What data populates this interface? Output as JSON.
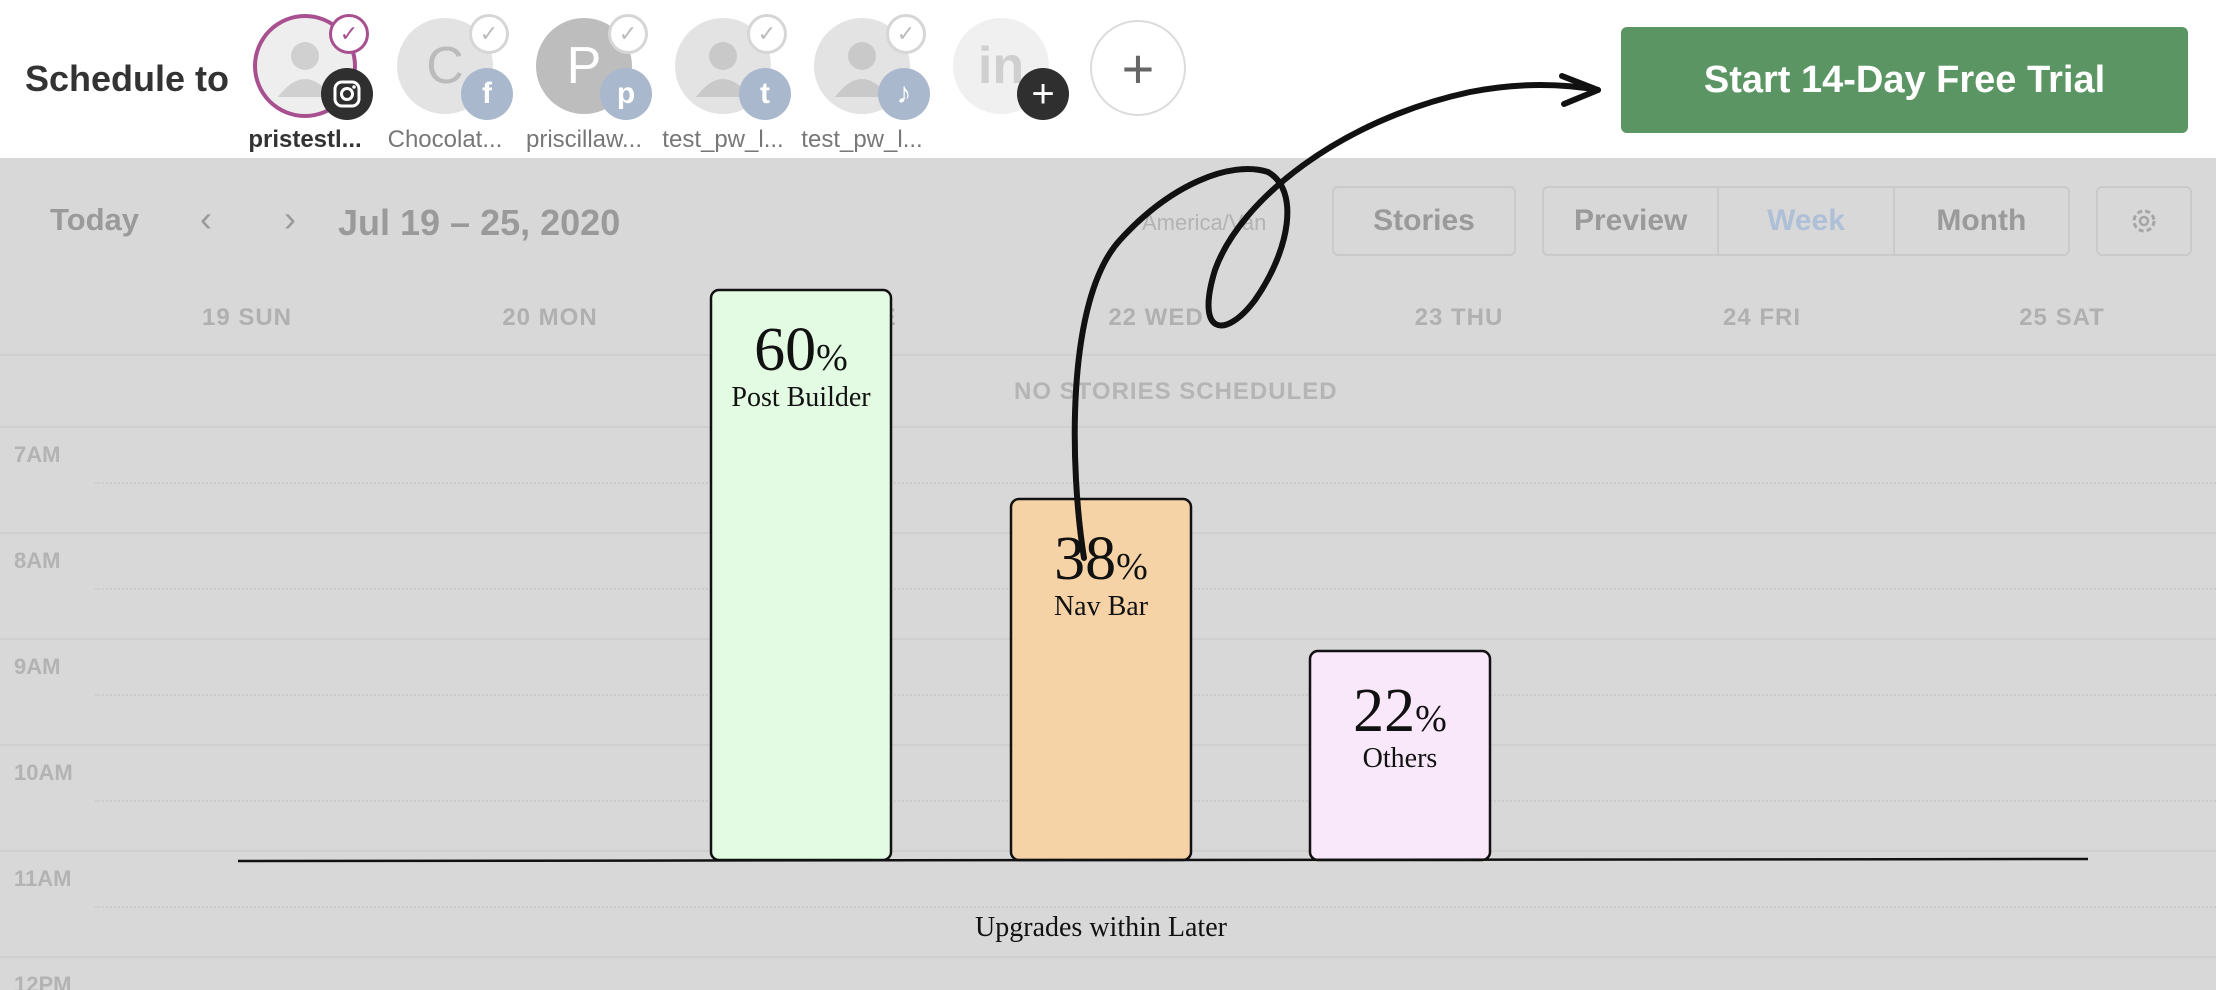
{
  "header": {
    "schedule_label": "Schedule to",
    "accounts": [
      {
        "name": "pristestl...",
        "avatar_letter": "",
        "network": "instagram-icon",
        "network_glyph": "◎",
        "active": true
      },
      {
        "name": "Chocolat...",
        "avatar_letter": "C",
        "network": "facebook-icon",
        "network_glyph": "f",
        "active": false
      },
      {
        "name": "priscillaw...",
        "avatar_letter": "P",
        "network": "pinterest-icon",
        "network_glyph": "p",
        "active": false
      },
      {
        "name": "test_pw_l...",
        "avatar_letter": "",
        "network": "twitter-icon",
        "network_glyph": "t",
        "active": false
      },
      {
        "name": "test_pw_l...",
        "avatar_letter": "",
        "network": "tiktok-icon",
        "network_glyph": "♪",
        "active": false
      },
      {
        "name": "",
        "avatar_letter": "in",
        "network": "add-icon",
        "network_glyph": "+",
        "active": false
      }
    ],
    "add_account_glyph": "+",
    "trial_button": "Start 14-Day Free Trial",
    "trial_color": "#5a9563",
    "accent_color": "#a84f90"
  },
  "calendar": {
    "today": "Today",
    "prev_glyph": "‹",
    "next_glyph": "›",
    "date_range": "Jul 19 – 25, 2020",
    "timezone": "America/Van",
    "stories": "Stories",
    "views": [
      "Preview",
      "Week",
      "Month"
    ],
    "selected_view": "Week",
    "days": [
      "19 SUN",
      "20 MON",
      "21 TUE",
      "22 WED",
      "23 THU",
      "24 FRI",
      "25 SAT"
    ],
    "no_stories": "NO STORIES SCHEDULED",
    "times": [
      "7AM",
      "8AM",
      "9AM",
      "10AM",
      "11AM",
      "12PM"
    ]
  },
  "chart_data": {
    "type": "bar",
    "categories": [
      "Post Builder",
      "Nav Bar",
      "Others"
    ],
    "values": [
      60,
      38,
      22
    ],
    "value_suffix": "%",
    "colors": [
      "#e2fbe2",
      "#f5d3a6",
      "#f9e7fa"
    ],
    "xlabel": "Upgrades within Later",
    "ylim": [
      0,
      60
    ]
  }
}
